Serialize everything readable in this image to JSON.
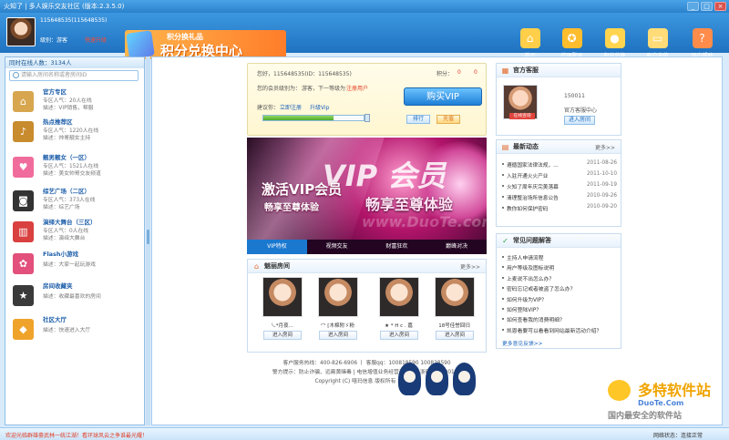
{
  "window": {
    "title": "火知了 | 多人娱乐交友社区 (版本:2.3.5.0)",
    "buttons": [
      "_",
      "□",
      "×"
    ]
  },
  "header": {
    "user_id_line": "115648535(115648535)",
    "level_label": "级别：游客",
    "upgrade_link": "快速升级",
    "banner_small": "积分换礼品",
    "banner_big": "积分兑换中心",
    "nav": [
      {
        "label": "首页",
        "icon": "house-icon",
        "color": "#ffcf4a",
        "symbol": "⌂"
      },
      {
        "label": "代理登录",
        "icon": "medal-icon",
        "color": "#ffbd2d",
        "symbol": "✪"
      },
      {
        "label": "积分兑换",
        "icon": "coins-icon",
        "color": "#ffd54f",
        "symbol": "●"
      },
      {
        "label": "账户充值",
        "icon": "card-icon",
        "color": "#ffdc77",
        "symbol": "▭"
      },
      {
        "label": "用户帮助",
        "icon": "user-help-icon",
        "color": "#ff8c4a",
        "symbol": "?"
      }
    ]
  },
  "left": {
    "online": "同时在线人数：3134人",
    "search_placeholder": "请输入房间名称或者房间ID",
    "rooms": [
      {
        "name": "官方专区",
        "line1": "专区人气：20人在线",
        "line2": "描述：VIP销售，帮服",
        "icon": "house-icon",
        "color": "#d7a64f",
        "symbol": "⌂"
      },
      {
        "name": "热点推荐区",
        "line1": "专区人气：1220人在线",
        "line2": "描述：帅哥靓女主持",
        "icon": "guitar-icon",
        "color": "#c88b2d",
        "symbol": "♪"
      },
      {
        "name": "靓男靓女（一区）",
        "line1": "专区人气：1521人在线",
        "line2": "描述：美女帅哥交友频道",
        "icon": "couple-icon",
        "color": "#f06c9c",
        "symbol": "♥"
      },
      {
        "name": "综艺广场（二区）",
        "line1": "专区人气：373人在线",
        "line2": "描述：综艺广场",
        "icon": "headphones-icon",
        "color": "#333333",
        "symbol": "◙"
      },
      {
        "name": "演绎大舞台（三区）",
        "line1": "专区人气：0人在线",
        "line2": "描述：演绎大舞台",
        "icon": "popcorn-icon",
        "color": "#d94040",
        "symbol": "▥"
      },
      {
        "name": "Flash小游戏",
        "line1": "描述：大家一起玩游戏",
        "line2": "",
        "icon": "game-icon",
        "color": "#e2507b",
        "symbol": "✿"
      },
      {
        "name": "房间收藏夹",
        "line1": "描述：收藏最喜欢的房间",
        "line2": "",
        "icon": "favorites-icon",
        "color": "#3a3a3a",
        "symbol": "★"
      },
      {
        "name": "社区大厅",
        "line1": "描述：快速进入大厅",
        "line2": "",
        "icon": "hall-icon",
        "color": "#f0a32a",
        "symbol": "◆"
      }
    ]
  },
  "welcome": {
    "greeting": "您好，115648535(ID：115648535)",
    "points_label": "积分：",
    "points": "0",
    "messages": "0",
    "level_prefix": "您的会员级别为：",
    "level_value": "游客，下一等级为",
    "register_link": "注册用户",
    "advice_prefix": "建议你：",
    "advice_links": [
      "立即注册",
      "升级Vip"
    ],
    "buy_vip": "购买VIP",
    "rank_button": "排行",
    "recharge_button": "充值",
    "progress": 0.7
  },
  "promo": {
    "vip_word": "VIP 会员",
    "line1": "激活VIP会员",
    "line2": "畅享至尊体验",
    "line3": "畅享至尊体验",
    "watermark": "www.DuoTe.com",
    "tabs": [
      "VIP特权",
      "视频交友",
      "财富狂欢",
      "巅峰对决"
    ]
  },
  "featured": {
    "title": "魅丽房间",
    "more": "更多>>",
    "rooms": [
      {
        "name": "乀*月夜...",
        "button": "进入房间"
      },
      {
        "name": "冖 [木棉附ゞ粉",
        "button": "进入房间"
      },
      {
        "name": "★ * H c . 嘉",
        "button": "进入房间"
      },
      {
        "name": "18号佳誉回归",
        "button": "进入房间"
      }
    ]
  },
  "footer": {
    "lines": [
      "客户服务热线：400-826-6906 丨 客服qq：100818590 100828590",
      "警方提示：防止诈骗、远离黄赌毒 | 电信增值业务经营许可证：浙B2-20090149",
      "Copyright (C) 嘻玛信息 版权所有 站长统计"
    ]
  },
  "sidebar": {
    "service": {
      "title": "官方客服",
      "id": "150011",
      "name": "官方客服中心",
      "button": "进入房间",
      "tag": "在线咨询"
    },
    "news": {
      "title": "最新动态",
      "more": "更多>>",
      "items": [
        {
          "title": "遵循国家法律法规，...",
          "date": "2011-08-26"
        },
        {
          "title": "入驻开通火火产业",
          "date": "2011-10-10"
        },
        {
          "title": "火知了周年庆完美落幕",
          "date": "2011-09-19"
        },
        {
          "title": "清理整治场所信息公告",
          "date": "2010-09-26"
        },
        {
          "title": "教你如何保护密码",
          "date": "2010-09-20"
        }
      ]
    },
    "faq": {
      "title": "常见问题解答",
      "items": [
        "主持人申请流程",
        "用户等级及图标说明",
        "上麦说不出怎么办？",
        "密码忘记或者被盗了怎么办？",
        "如何升级为VIP？",
        "如何登陆VIP？",
        "如何查看我的消费明细？",
        "凯恩看要可以看看到网站最新活动介绍？"
      ],
      "more": "更多意见反馈>>"
    }
  },
  "watermark_logo": {
    "top": "多特软件站",
    "mid": "DuoTe.Com",
    "bottom": "国内最安全的软件站"
  },
  "status": {
    "ticker": "欢迎光临群雄豪武林一统江湖！看环球风云之争谁最光耀！",
    "network": "网络状态：连接正常"
  },
  "colors": {
    "primary": "#1f76c3",
    "accent": "#ff8a1f",
    "warning": "#e13e24"
  }
}
